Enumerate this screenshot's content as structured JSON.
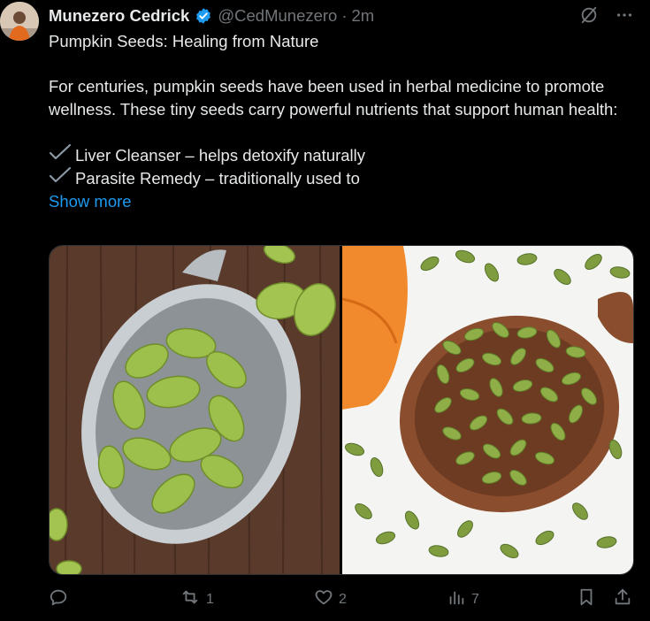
{
  "post": {
    "author_name": "Munezero Cedrick",
    "handle": "@CedMunezero",
    "separator": "·",
    "time": "2m",
    "title": "Pumpkin Seeds: Healing from Nature",
    "paragraph": "For centuries, pumpkin seeds have been used in herbal medicine to promote wellness. These tiny seeds carry powerful nutrients that support human health:",
    "bullets": [
      "Liver Cleanser – helps detoxify naturally",
      "Parasite Remedy – traditionally used to"
    ],
    "bullet_icon": "check-mark-icon",
    "show_more": "Show more"
  },
  "actions": {
    "replies": "",
    "reposts": "1",
    "likes": "2",
    "views": "7"
  },
  "colors": {
    "background": "#000000",
    "text": "#e7e9ea",
    "muted": "#71767b",
    "link": "#1d9bf0",
    "verified": "#1d9bf0"
  }
}
